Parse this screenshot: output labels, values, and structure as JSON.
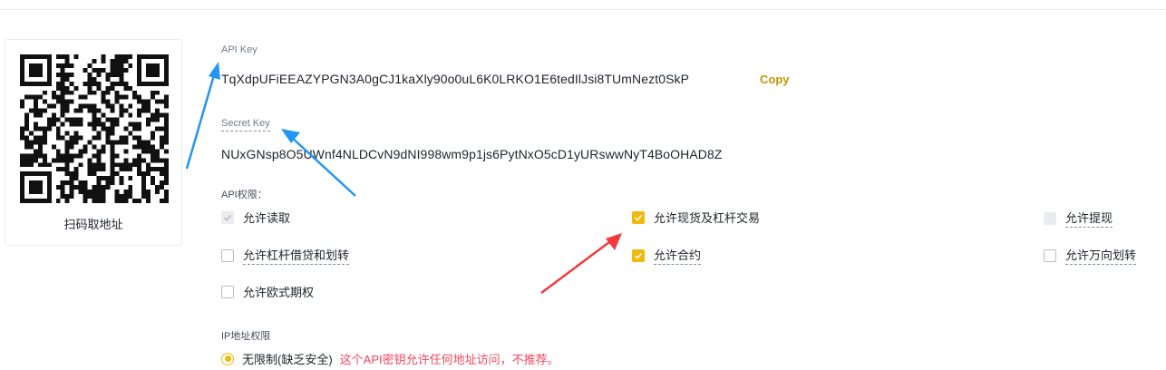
{
  "qr": {
    "caption": "扫码取地址"
  },
  "api_key": {
    "label": "API Key",
    "value": "TqXdpUFiEEAZYPGN3A0gCJ1kaXly90o0uL6K0LRKO1E6tedIlJsi8TUmNezt0SkP",
    "copy_label": "Copy"
  },
  "secret_key": {
    "label": "Secret Key",
    "value": "NUxGNsp8O5UWnf4NLDCvN9dNI998wm9p1js6PytNxO5cD1yURswwNyT4BoOHAD8Z"
  },
  "permissions": {
    "label": "API权限：",
    "items": [
      {
        "label": "允许读取",
        "checked": true,
        "disabled": true
      },
      {
        "label": "允许现货及杠杆交易",
        "checked": true,
        "disabled": false
      },
      {
        "label": "允许提现",
        "checked": false,
        "disabled": true
      },
      {
        "label": "允许杠杆借贷和划转",
        "checked": false,
        "disabled": false
      },
      {
        "label": "允许合约",
        "checked": true,
        "disabled": false
      },
      {
        "label": "允许万向划转",
        "checked": false,
        "disabled": false
      },
      {
        "label": "允许欧式期权",
        "checked": false,
        "disabled": false
      }
    ]
  },
  "ip_restriction": {
    "label": "IP地址权限",
    "option_label": "无限制(缺乏安全)",
    "warning": "这个API密钥允许任何地址访问，不推荐。",
    "selected": true
  },
  "colors": {
    "accent": "#f0b90b",
    "copy": "#c99400",
    "warning": "#f6465d",
    "arrow_blue": "#2196f3",
    "arrow_red": "#f23a3a"
  }
}
